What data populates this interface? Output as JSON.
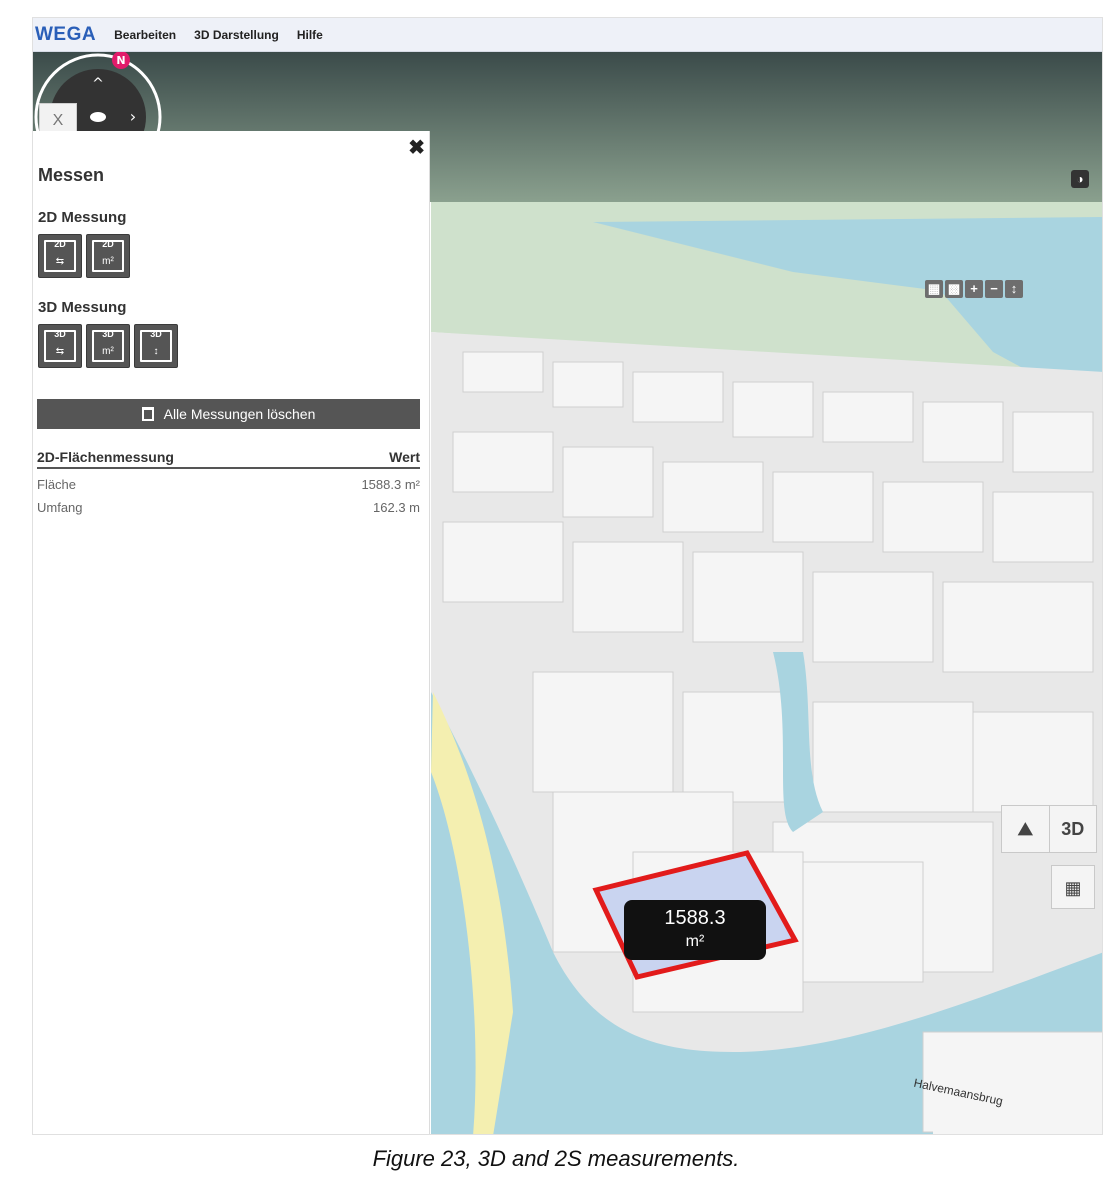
{
  "menubar": {
    "brand": "WEGA",
    "items": [
      "Bearbeiten",
      "3D Darstellung",
      "Hilfe"
    ]
  },
  "tab": {
    "close_label": "X"
  },
  "panel": {
    "close_label": "✖",
    "title": "Messen",
    "section_2d": "2D Messung",
    "section_3d": "3D Messung",
    "tools_2d": [
      {
        "label": "2D",
        "sub": "⇆"
      },
      {
        "label": "2D",
        "sub": "m²"
      }
    ],
    "tools_3d": [
      {
        "label": "3D",
        "sub": "⇆"
      },
      {
        "label": "3D",
        "sub": "m²"
      },
      {
        "label": "3D",
        "sub": "↕"
      }
    ],
    "clear_button": "Alle Messungen löschen",
    "results": {
      "col_left": "2D-Flächenmessung",
      "col_right": "Wert",
      "rows": [
        {
          "label": "Fläche",
          "value": "1588.3 m²"
        },
        {
          "label": "Umfang",
          "value": "162.3 m"
        }
      ]
    }
  },
  "map": {
    "compass_north": "N",
    "zoom_controls": [
      "▦",
      "▩",
      "+",
      "−",
      "↕"
    ],
    "contrast_icon": "◑",
    "view_switch": {
      "option_2d": "⛰",
      "option_3d": "3D"
    },
    "grid_icon": "▦",
    "measurement_label": {
      "value": "1588.3",
      "unit": "m²"
    },
    "street_labels": [
      "Halvemaansbrug"
    ]
  },
  "caption": "Figure 23, 3D and 2S measurements."
}
